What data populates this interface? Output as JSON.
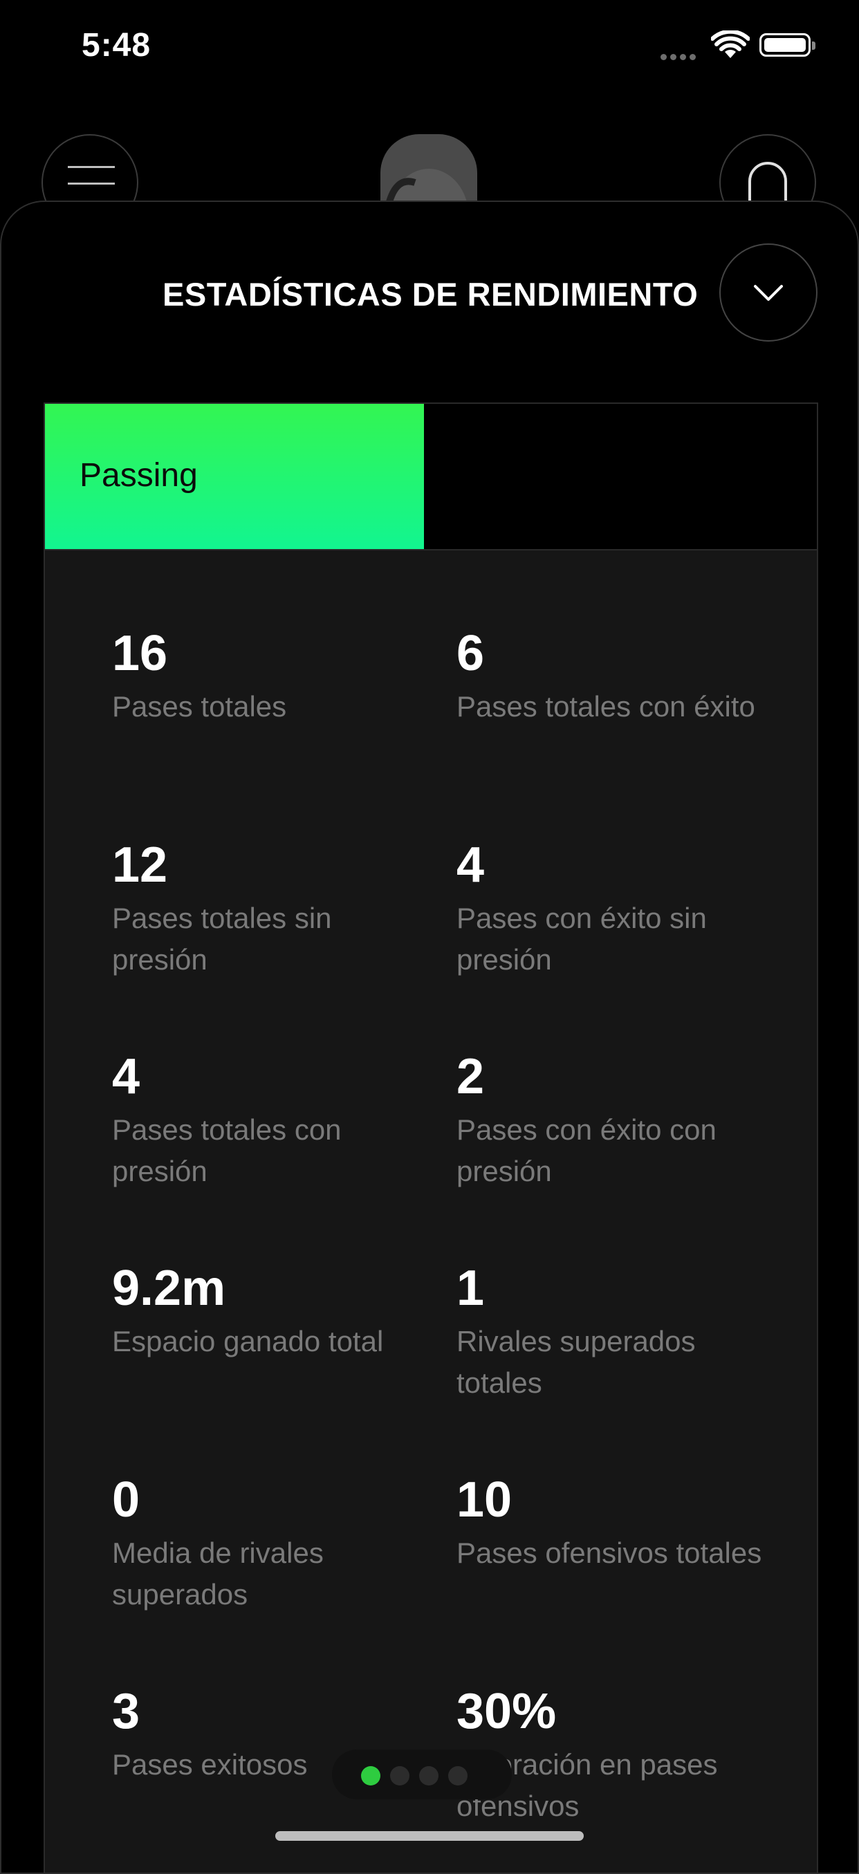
{
  "status_bar": {
    "time": "5:48"
  },
  "sheet": {
    "title": "ESTADÍSTICAS DE RENDIMIENTO"
  },
  "tabs": [
    {
      "label": "Passing",
      "active": true
    }
  ],
  "stats": [
    {
      "value": "16",
      "label": "Pases totales"
    },
    {
      "value": "6",
      "label": "Pases totales con éxito"
    },
    {
      "value": "12",
      "label": "Pases totales sin presión"
    },
    {
      "value": "4",
      "label": "Pases con éxito sin presión"
    },
    {
      "value": "4",
      "label": "Pases totales con presión"
    },
    {
      "value": "2",
      "label": "Pases con éxito con presión"
    },
    {
      "value": "9.2m",
      "label": "Espacio ganado total"
    },
    {
      "value": "1",
      "label": "Rivales superados totales"
    },
    {
      "value": "0",
      "label": "Media de rivales superados"
    },
    {
      "value": "10",
      "label": "Pases ofensivos totales"
    },
    {
      "value": "3",
      "label": "Pases exitosos"
    },
    {
      "value": "30%",
      "label": "Valoración en pases ofensivos"
    }
  ],
  "pager": {
    "pages": 4,
    "active_index": 0
  },
  "colors": {
    "accent_green_top": "#33f552",
    "accent_green_bottom": "#12f590",
    "active_dot": "#2ecc40"
  },
  "icons": [
    "menu-icon",
    "bell-icon",
    "chevron-down-icon",
    "wifi-icon",
    "battery-icon",
    "signal-icon"
  ]
}
